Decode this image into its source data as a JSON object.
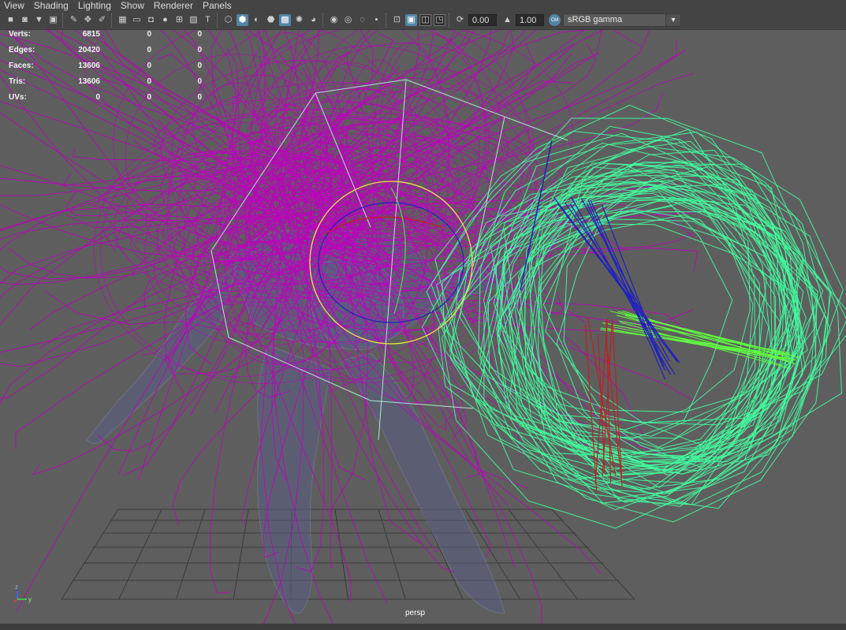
{
  "menu": [
    "View",
    "Shading",
    "Lighting",
    "Show",
    "Renderer",
    "Panels"
  ],
  "toolbar": {
    "icons": [
      "camera-icon",
      "camera-attrs-icon",
      "bookmark-icon",
      "image-plane-icon",
      "sep",
      "grease-pencil-icon",
      "2d-pan-icon",
      "brush-icon",
      "sep",
      "grid-icon",
      "film-gate-icon",
      "resolution-gate-icon",
      "gate-mask-icon",
      "field-chart-icon",
      "safe-action-icon",
      "safe-title-icon",
      "sep",
      "wireframe-icon",
      "smooth-shade-icon",
      "wireframe-on-shaded-icon",
      "flat-shade-icon",
      "textures-icon",
      "lights-icon",
      "shadows-icon",
      "sep",
      "screen-space-ao-icon",
      "motion-blur-icon",
      "antialias-icon",
      "depth-of-field-icon",
      "sep",
      "isolate-select-icon",
      "xray-icon",
      "xray-joints-icon",
      "xray-active-icon",
      "sep",
      "exposure-reset-icon"
    ],
    "active_icons": [
      "smooth-shade-icon",
      "textures-icon",
      "xray-icon"
    ],
    "exposure": "0.00",
    "gamma": "1.00",
    "color_management_badge": "CM",
    "color_space": "sRGB gamma"
  },
  "hud": [
    {
      "label": "Verts:",
      "v1": "6815",
      "v2": "0",
      "v3": "0"
    },
    {
      "label": "Edges:",
      "v1": "20420",
      "v2": "0",
      "v3": "0"
    },
    {
      "label": "Faces:",
      "v1": "13606",
      "v2": "0",
      "v3": "0"
    },
    {
      "label": "Tris:",
      "v1": "13606",
      "v2": "0",
      "v3": "0"
    },
    {
      "label": "UVs:",
      "v1": "0",
      "v2": "0",
      "v3": "0"
    }
  ],
  "viewport": {
    "camera": "persp",
    "axis_labels": {
      "z": "z",
      "y": "y"
    },
    "colors": {
      "background": "#5e5e5e",
      "grid": "#3a3a3a",
      "curves": "#c000c0",
      "green_curves": "#40ffa0",
      "selected_curves": "#20c080",
      "joint_blue": "#2020c0",
      "joint_red": "#c02020",
      "ctrl_yellow": "#e8e840",
      "mesh": "#5a5f85"
    }
  }
}
